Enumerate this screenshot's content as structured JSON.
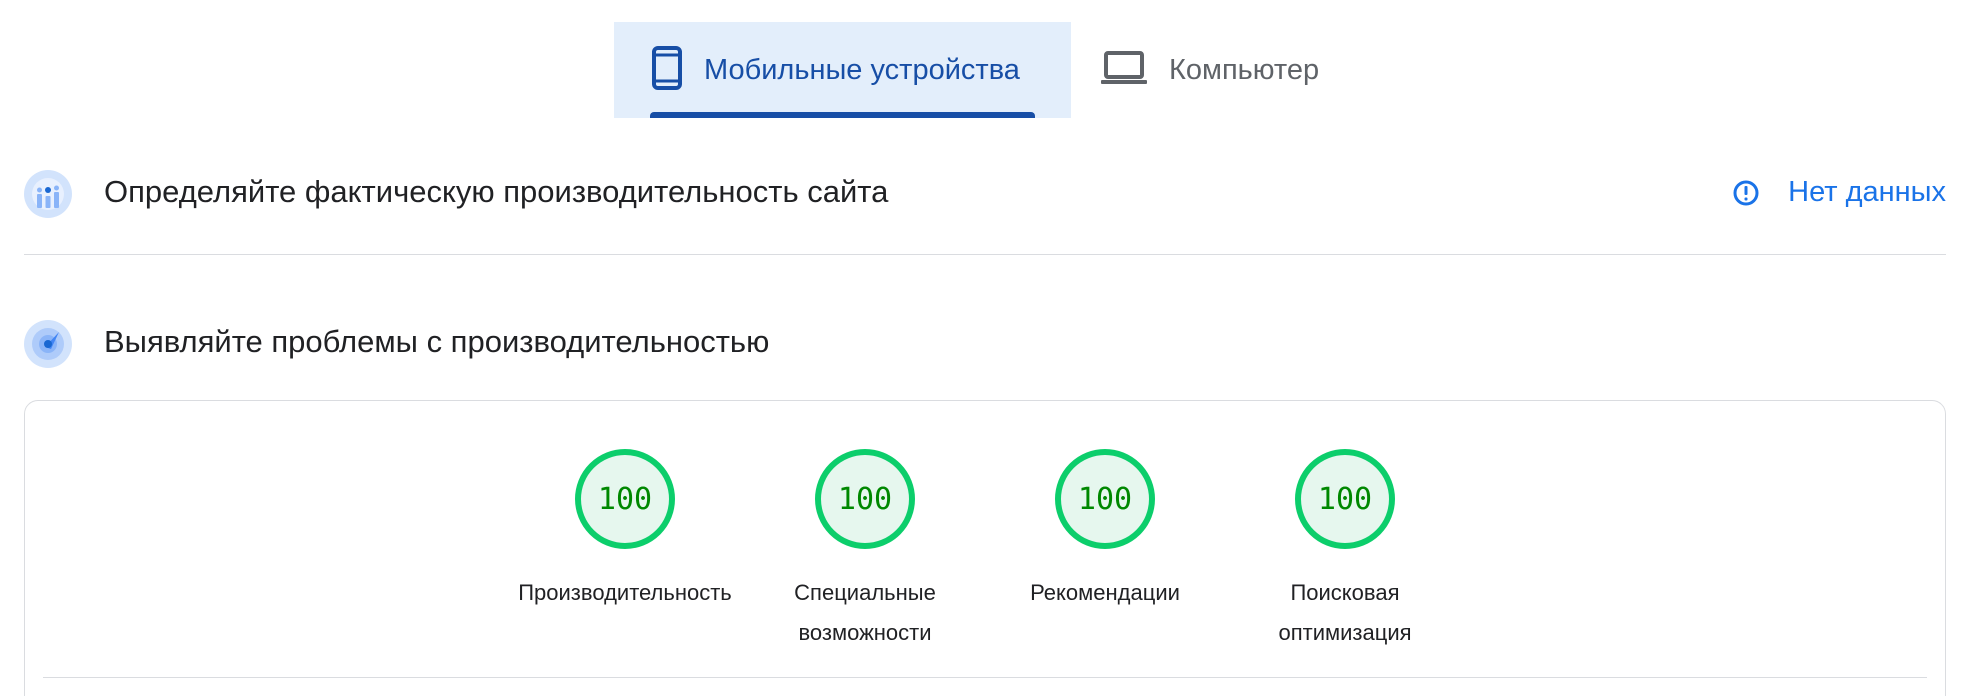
{
  "tabs": [
    {
      "label": "Мобильные устройства",
      "icon": "smartphone-icon",
      "selected": true
    },
    {
      "label": "Компьютер",
      "icon": "laptop-icon",
      "selected": false
    }
  ],
  "crux": {
    "title": "Определяйте фактическую производительность сайта",
    "icon": "field-data-icon",
    "status_label": "Нет данных",
    "status_icon": "info-icon"
  },
  "lighthouse": {
    "title": "Выявляйте проблемы с производительностью",
    "icon": "lighthouse-icon",
    "scores": [
      {
        "value": "100",
        "label_line1": "Производительность",
        "label_line2": ""
      },
      {
        "value": "100",
        "label_line1": "Специальные",
        "label_line2": "возможности"
      },
      {
        "value": "100",
        "label_line1": "Рекомендации",
        "label_line2": ""
      },
      {
        "value": "100",
        "label_line1": "Поисковая",
        "label_line2": "оптимизация"
      }
    ]
  },
  "colors": {
    "accent": "#1a73e8",
    "tab_selected_text": "#174ea6",
    "tab_selected_bg": "#e3eefb",
    "score_good": "#0cce6b",
    "score_good_text": "#008800"
  }
}
